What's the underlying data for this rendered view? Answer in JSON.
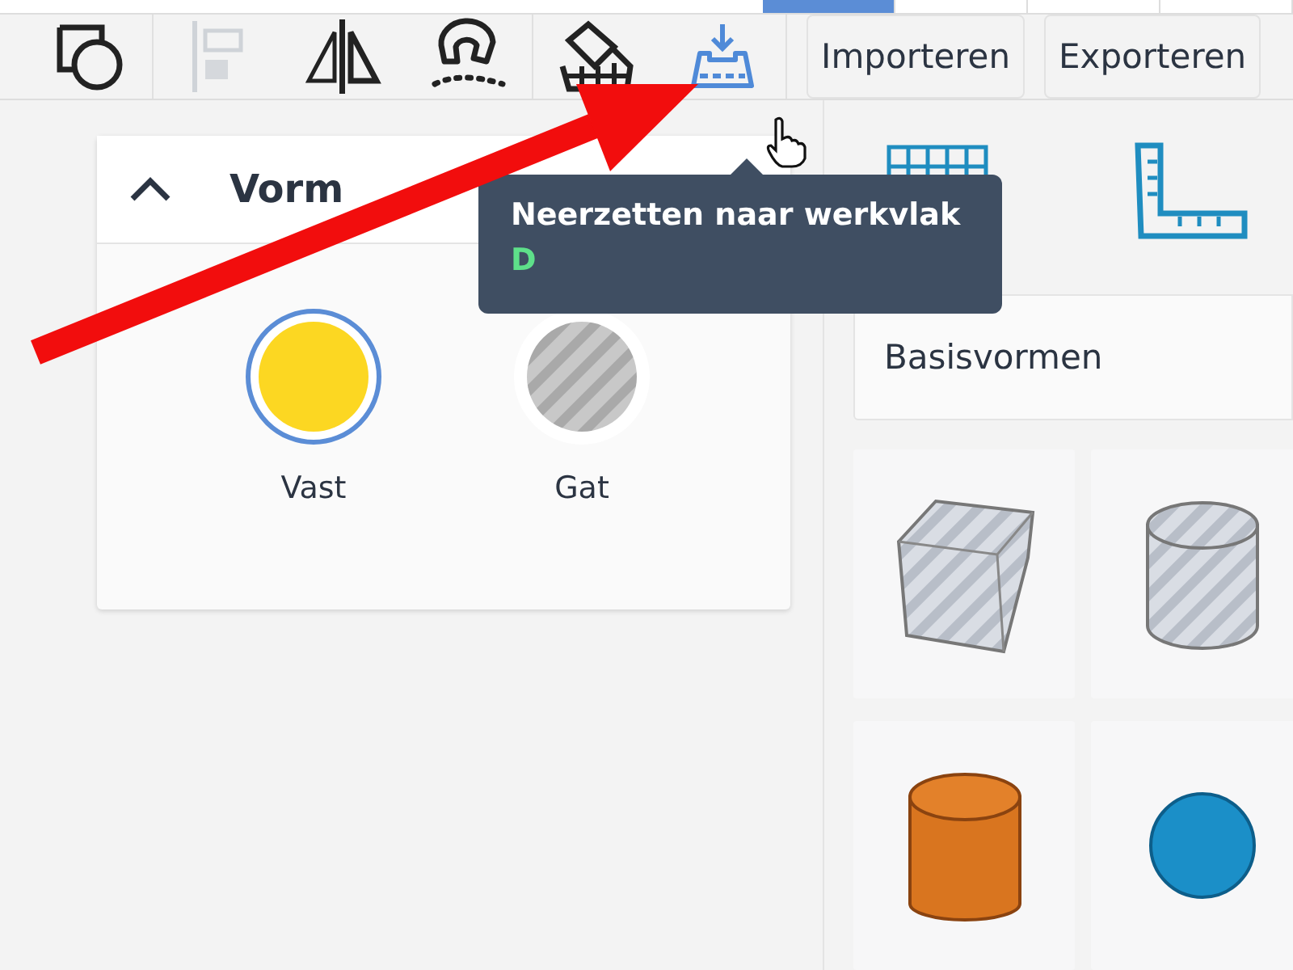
{
  "top_tabs": [
    {
      "selected": true
    },
    {
      "selected": false
    },
    {
      "selected": false
    },
    {
      "selected": false
    }
  ],
  "toolbar": {
    "buttons": [
      "Importeren",
      "Exporteren"
    ]
  },
  "tooltip": {
    "title": "Neerzetten naar werkvlak",
    "shortcut": "D"
  },
  "panel": {
    "title": "Vorm",
    "expanded": true,
    "options": [
      {
        "label": "Vast",
        "kind": "solid",
        "selected": true
      },
      {
        "label": "Gat",
        "kind": "hole",
        "selected": false
      }
    ]
  },
  "library": {
    "category": "Basisvormen",
    "shapes": [
      {
        "kind": "box-hole"
      },
      {
        "kind": "cylinder-hole"
      },
      {
        "kind": "cylinder"
      },
      {
        "kind": "sphere"
      }
    ]
  }
}
